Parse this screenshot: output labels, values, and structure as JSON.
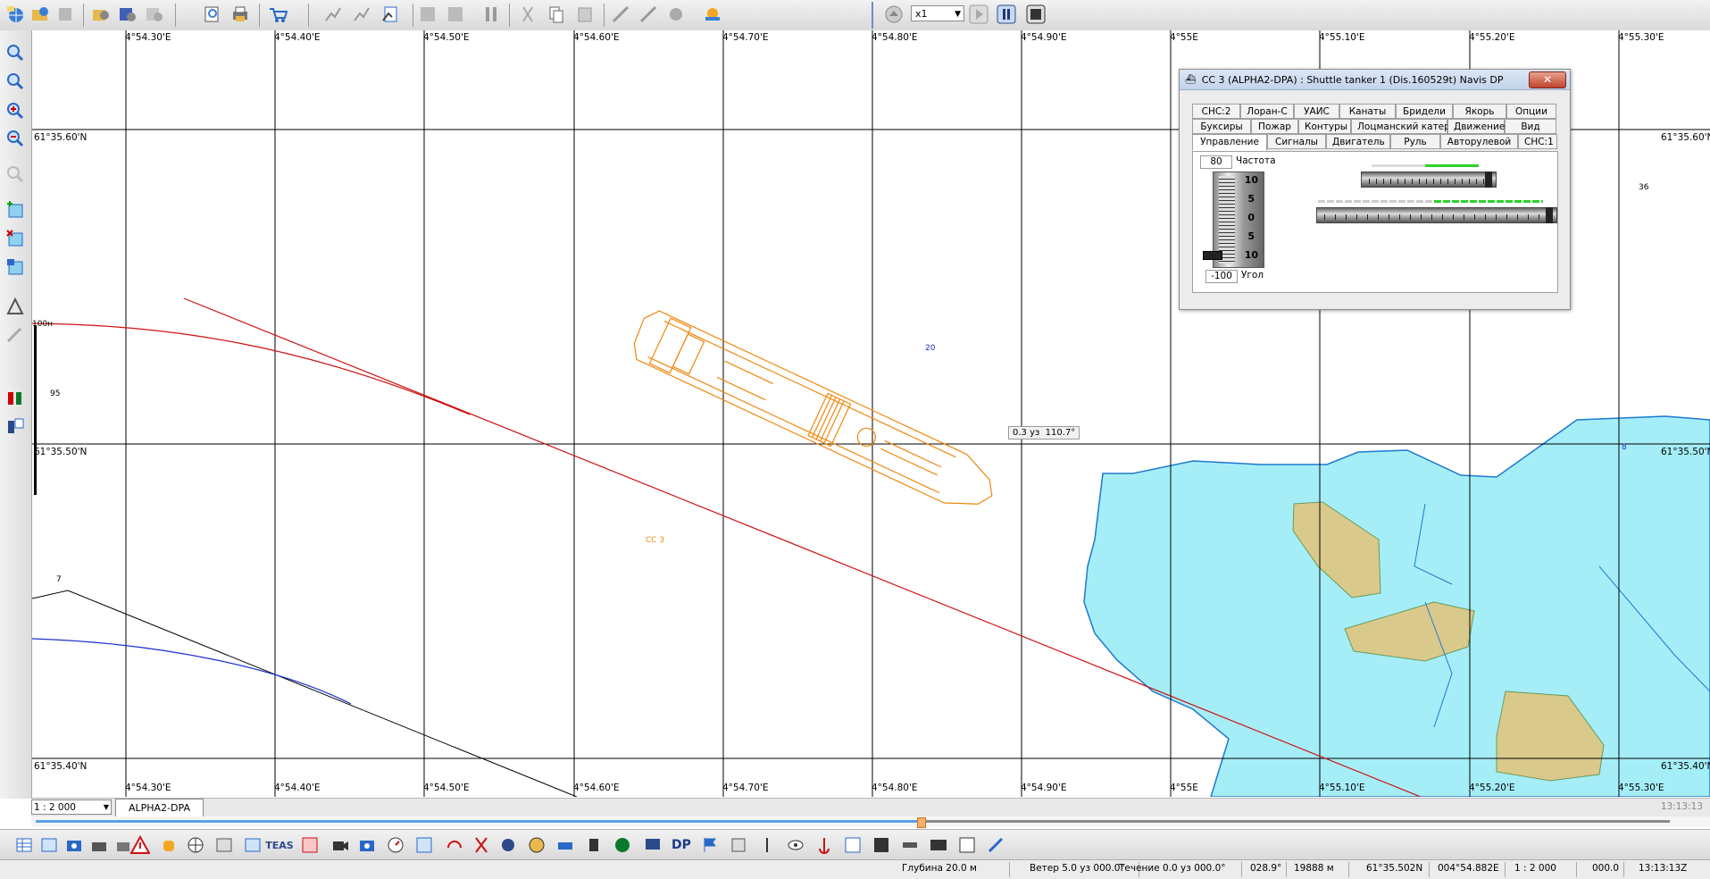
{
  "toolbar_top": {
    "speed_value": "x1",
    "icons": [
      "globe-open-icon",
      "open-folder-icon",
      "save-icon",
      "gear-settings-icon",
      "gear-save-icon",
      "gear-export-icon",
      "zoom-window-icon",
      "print-icon",
      "cart-icon",
      "route-add-icon",
      "route-edit-icon",
      "route-list-icon",
      "grid-a-icon",
      "grid-b-icon",
      "tool-a-icon",
      "cut-icon",
      "copy-icon",
      "paste-icon",
      "draw-a-icon",
      "draw-b-icon",
      "draw-c-icon",
      "weather-icon"
    ],
    "playback": [
      "eject-icon",
      "play-icon",
      "pause-icon",
      "stop-icon"
    ]
  },
  "toolbar_left": {
    "icons": [
      "zoom-in-icon",
      "zoom-window-icon",
      "zoom-plus-icon",
      "zoom-minus-icon",
      "zoom-disabled-icon",
      "map-add-icon",
      "map-remove-icon",
      "map-info-icon",
      "triangle-tool-icon",
      "pen-tool-icon",
      "people-icon",
      "person-id-icon"
    ]
  },
  "chart": {
    "lon_labels": [
      "4°54.30'E",
      "4°54.40'E",
      "4°54.50'E",
      "4°54.60'E",
      "4°54.70'E",
      "4°54.80'E",
      "4°54.90'E",
      "4°55E",
      "4°55.10'E",
      "4°55.20'E",
      "4°55.30'E"
    ],
    "lat_labels": [
      "61°35.60'N",
      "61°35.50'N",
      "61°35.40'N"
    ],
    "depth_labels": [
      "100н",
      "95",
      "7",
      "20",
      "36",
      "8"
    ],
    "vessel_label": "CC 3",
    "speed_tooltip": "0.3 уз  110.7°"
  },
  "dialog": {
    "title": "CC 3 (ALPHA2-DPA) : Shuttle tanker 1 (Dis.160529t) Navis DP",
    "close_label": "✕",
    "tabs_row1": [
      "СНС:2",
      "Лоран-С",
      "УАИС",
      "Канаты",
      "Бридели",
      "Якорь",
      "Опции"
    ],
    "tabs_row2": [
      "Буксиры",
      "Пожар",
      "Контуры",
      "Лоцманский катер",
      "Движение",
      "Вид"
    ],
    "tabs_row3": [
      "Управление",
      "Сигналы",
      "Двигатель",
      "Руль",
      "Авторулевой",
      "СНС:1"
    ],
    "freq_value": "80",
    "freq_label": "Частота",
    "angle_value": "-100",
    "angle_label": "Угол",
    "scale_marks": [
      "10",
      "5",
      "0",
      "5",
      "10"
    ],
    "slider_top_level": 0.85,
    "slider_bottom_level": 1.0
  },
  "scale_bar": {
    "scale_value": "1 : 2 000",
    "chart_tab": "ALPHA2-DPA",
    "time": "13:13:13"
  },
  "toolbar_bottom": {
    "icons": [
      "table-icon",
      "chart-icon",
      "camera-icon",
      "camera-b-icon",
      "warning-icon",
      "alarm-icon",
      "compass-icon",
      "panel-icon",
      "panel-b-icon",
      "teas-icon",
      "map-pin-icon",
      "video-icon",
      "photo-icon",
      "gauge-icon",
      "radar-icon",
      "headset-icon",
      "scissors-icon",
      "gear-icon",
      "sphere-icon",
      "bridge-icon",
      "hand-icon",
      "radio-icon",
      "monitor-icon",
      "dp-icon",
      "flag-icon",
      "gear-b-icon",
      "eye-icon",
      "anchor-icon",
      "gps-icon",
      "ais-icon",
      "satellite-icon",
      "clock-icon",
      "calendar-icon",
      "tools-icon"
    ],
    "teas_label": "TEAS",
    "dp_label": "DP"
  },
  "statusbar": {
    "depth": "Глубина 20.0 м",
    "wind": "Ветер 5.0 уз 000.0°",
    "current": "Течение 0.0 уз 000.0°",
    "course": "028.9°",
    "distance": "19888 м",
    "lat": "61°35.502N",
    "lon": "004°54.882E",
    "scale": "1 : 2 000",
    "value": "000.0",
    "time": "13:13:13Z"
  }
}
